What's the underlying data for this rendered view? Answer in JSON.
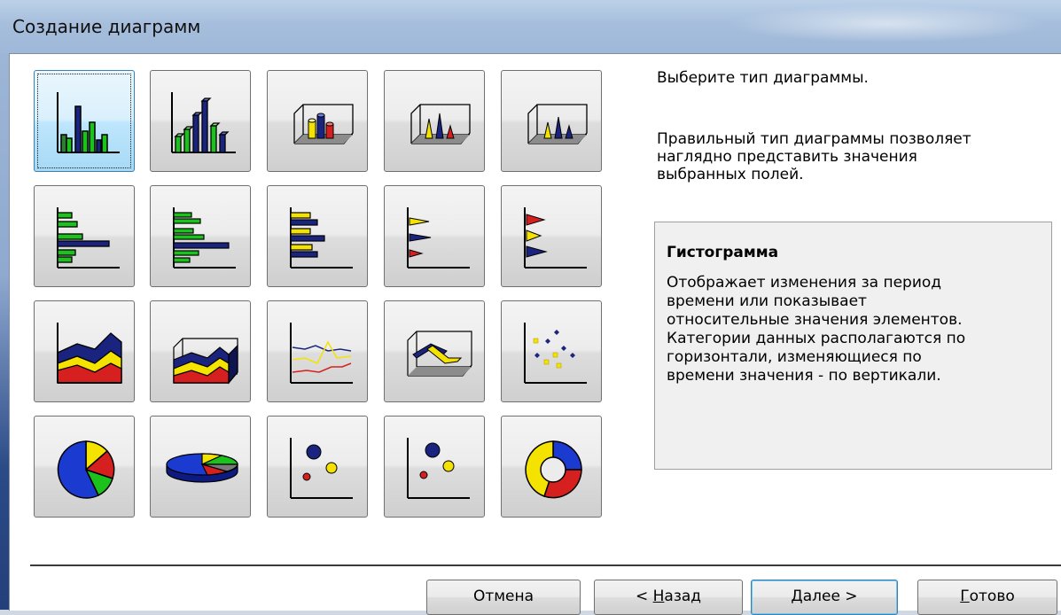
{
  "window": {
    "title": "Создание диаграмм"
  },
  "chart_types": {
    "selected_index": 0,
    "rows": [
      [
        "column-clustered-icon",
        "column-3d-effect-icon",
        "column-3d-cylinder-icon",
        "column-3d-cone-icon",
        "column-3d-pyramid-icon"
      ],
      [
        "bar-clustered-icon",
        "bar-3d-effect-icon",
        "bar-3d-cylinder-icon",
        "bar-3d-cone-icon",
        "bar-3d-pyramid-icon"
      ],
      [
        "area-icon",
        "area-3d-icon",
        "line-icon",
        "line-3d-icon",
        "xy-scatter-icon"
      ],
      [
        "pie-icon",
        "pie-3d-icon",
        "bubble-icon",
        "bubble-3d-icon",
        "doughnut-icon"
      ]
    ]
  },
  "panel": {
    "prompt": "Выберите тип диаграммы.",
    "hint": "Правильный тип диаграммы позволяет\nнаглядно представить значения\nвыбранных полей.",
    "description": {
      "title": "Гистограмма",
      "text": "Отображает изменения за период\nвремени или показывает\nотносительные значения элементов.\nКатегории данных располагаются по\nгоризонтали, изменяющиеся по\nвремени значения - по вертикали."
    }
  },
  "buttons": {
    "cancel": "Отмена",
    "back_prefix": "< ",
    "back_mnemonic": "Н",
    "back_rest": "азад",
    "next_mnemonic": "Д",
    "next_rest": "алее >",
    "finish_mnemonic": "Г",
    "finish_rest": "отово"
  }
}
